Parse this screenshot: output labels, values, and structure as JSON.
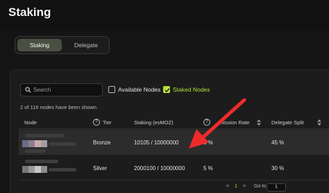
{
  "header": {
    "title": "Staking"
  },
  "tabs": [
    {
      "label": "Staking",
      "active": true
    },
    {
      "label": "Delegate",
      "active": false
    }
  ],
  "filters": {
    "search_placeholder": "Search",
    "available_nodes": {
      "label": "Available Nodes",
      "checked": false
    },
    "staked_nodes": {
      "label": "Staked Nodes",
      "checked": true
    }
  },
  "count_text": "2 of 116 nodes have been shown.",
  "table": {
    "columns": [
      "Node",
      "Tier",
      "Staking (esMOZ)",
      "mission Rate",
      "Delegate Split"
    ],
    "rows": [
      {
        "tier": "Bronze",
        "staking": "10105 / 10000000",
        "commission": "5 %",
        "split": "45 %"
      },
      {
        "tier": "Silver",
        "staking": "2000100 / 10000000",
        "commission": "5 %",
        "split": "30 %"
      }
    ]
  },
  "pagination": {
    "prev": "<",
    "current_page": "1",
    "next": ">",
    "goto_label": "Go to",
    "goto_value": "1"
  },
  "colors": {
    "accent": "#b6e03a",
    "annotation_arrow": "#ee2b2b",
    "background": "#141414"
  }
}
